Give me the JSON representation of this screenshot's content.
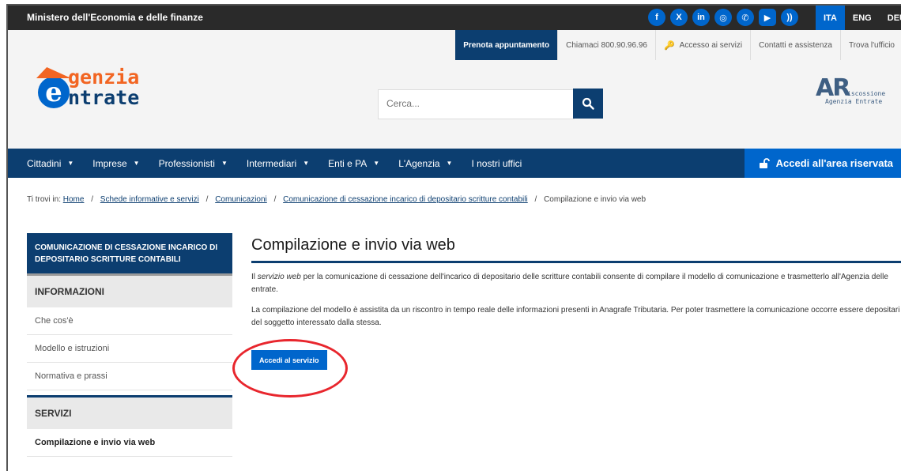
{
  "topbar": {
    "ministry": "Ministero dell'Economia e delle finanze",
    "socials": [
      {
        "icon": "facebook-icon",
        "glyph": "f"
      },
      {
        "icon": "x-icon",
        "glyph": "X"
      },
      {
        "icon": "linkedin-icon",
        "glyph": "in"
      },
      {
        "icon": "instagram-icon",
        "glyph": "◎"
      },
      {
        "icon": "whatsapp-icon",
        "glyph": "✆"
      },
      {
        "icon": "youtube-icon",
        "glyph": "▶"
      },
      {
        "icon": "rss-icon",
        "glyph": "))"
      }
    ],
    "languages": [
      "ITA",
      "ENG",
      "DEU"
    ],
    "active_language": "ITA"
  },
  "utility": {
    "prenota": "Prenota appuntamento",
    "chiamaci": "Chiamaci 800.90.96.96",
    "accesso": "Accesso ai servizi",
    "contatti": "Contatti e assistenza",
    "trova": "Trova l'ufficio"
  },
  "logo": {
    "line1": "genzia",
    "line2": "ntrate",
    "initial": "e"
  },
  "search": {
    "placeholder": "Cerca..."
  },
  "ar_logo": {
    "mark": "AR",
    "line1": "iscossione",
    "line2": "Agenzia Entrate"
  },
  "nav": {
    "items": [
      "Cittadini",
      "Imprese",
      "Professionisti",
      "Intermediari",
      "Enti e PA",
      "L'Agenzia",
      "I nostri uffici"
    ],
    "login": "Accedi all'area riservata"
  },
  "breadcrumb": {
    "prefix": "Ti trovi in:",
    "links": [
      "Home",
      "Schede informative e servizi",
      "Comunicazioni",
      "Comunicazione di cessazione incarico di depositario scritture contabili"
    ],
    "current": "Compilazione e invio via web"
  },
  "sidebar": {
    "header": "COMUNICAZIONE DI CESSAZIONE INCARICO DI DEPOSITARIO SCRITTURE CONTABILI",
    "section1": "INFORMAZIONI",
    "items1": [
      "Che cos'è",
      "Modello e istruzioni",
      "Normativa e prassi"
    ],
    "section2": "SERVIZI",
    "items2": [
      "Compilazione e invio via web"
    ]
  },
  "main": {
    "title": "Compilazione e invio via web",
    "p1_prefix": "Il",
    "p1_em": "servizio web",
    "p1_rest": "per la comunicazione di cessazione dell'incarico di depositario delle scritture contabili consente di compilare il modello di comunicazione e trasmetterlo all'Agenzia delle entrate.",
    "p2": "La compilazione del modello è assistita da un riscontro in tempo reale delle informazioni presenti in Anagrafe Tributaria. Per poter trasmettere la comunicazione occorre essere depositari del soggetto interessato dalla stessa.",
    "button": "Accedi al servizio"
  },
  "colors": {
    "navy": "#0c3e70",
    "blue": "#0066cc",
    "orange": "#f26522",
    "highlight_circle": "#e8262d"
  }
}
